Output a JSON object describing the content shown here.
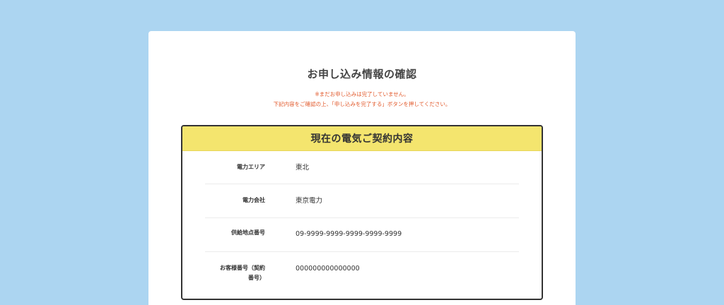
{
  "page": {
    "title": "お申し込み情報の確認",
    "notice_line1": "※まだお申し込みは完了していません。",
    "notice_line2": "下記内容をご確認の上、「申し込みを完了する」ボタンを押してください。"
  },
  "contract": {
    "header": "現在の電気ご契約内容",
    "rows": [
      {
        "label": "電力エリア",
        "value": "東北"
      },
      {
        "label": "電力会社",
        "value": "東京電力"
      },
      {
        "label": "供給地点番号",
        "value": "09-9999-9999-9999-9999-9999"
      },
      {
        "label_line1": "お客様番号（契約",
        "label_line2": "番号）",
        "value": "000000000000000"
      }
    ]
  },
  "colors": {
    "background": "#acd5f1",
    "header_yellow": "#f4e56e",
    "notice_red": "#e25a2c"
  }
}
